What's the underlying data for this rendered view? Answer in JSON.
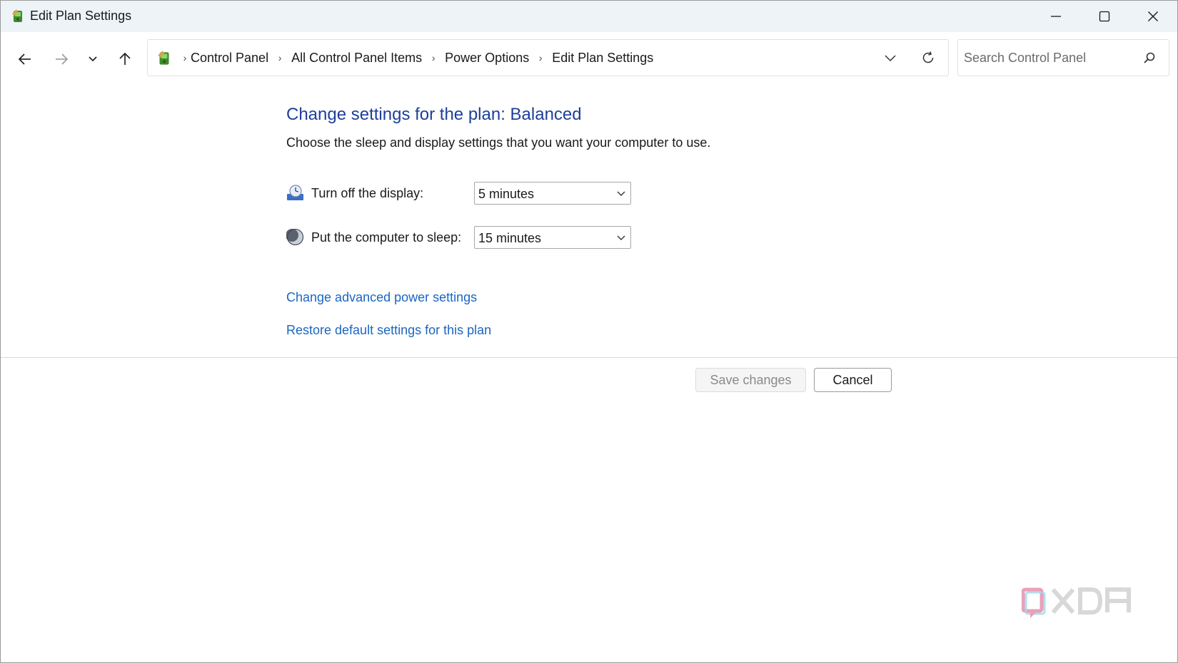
{
  "window": {
    "title": "Edit Plan Settings",
    "controls": {
      "minimize": "minimize-icon",
      "maximize": "maximize-icon",
      "close": "close-icon"
    }
  },
  "nav": {
    "back_icon": "arrow-left-icon",
    "forward_icon": "arrow-right-icon",
    "recent_icon": "chevron-down-icon",
    "up_icon": "arrow-up-icon"
  },
  "address": {
    "icon": "power-options-icon",
    "breadcrumbs": [
      "Control Panel",
      "All Control Panel Items",
      "Power Options",
      "Edit Plan Settings"
    ],
    "dropdown_icon": "chevron-down-icon",
    "refresh_icon": "refresh-icon"
  },
  "search": {
    "placeholder": "Search Control Panel",
    "value": "",
    "icon": "search-icon"
  },
  "main": {
    "title": "Change settings for the plan: Balanced",
    "subtitle": "Choose the sleep and display settings that you want your computer to use.",
    "settings": [
      {
        "label": "Turn off the display:",
        "value": "5 minutes",
        "icon": "display-clock-icon"
      },
      {
        "label": "Put the computer to sleep:",
        "value": "15 minutes",
        "icon": "moon-icon"
      }
    ],
    "links": {
      "advanced": "Change advanced power settings",
      "restore": "Restore default settings for this plan"
    },
    "buttons": {
      "save": "Save changes",
      "cancel": "Cancel"
    }
  },
  "watermark": {
    "text": "XDA",
    "icon": "xda-logo"
  },
  "colors": {
    "title_blue": "#1e3f9a",
    "link_blue": "#1a66c2",
    "titlebar_bg": "#eef3f8"
  }
}
